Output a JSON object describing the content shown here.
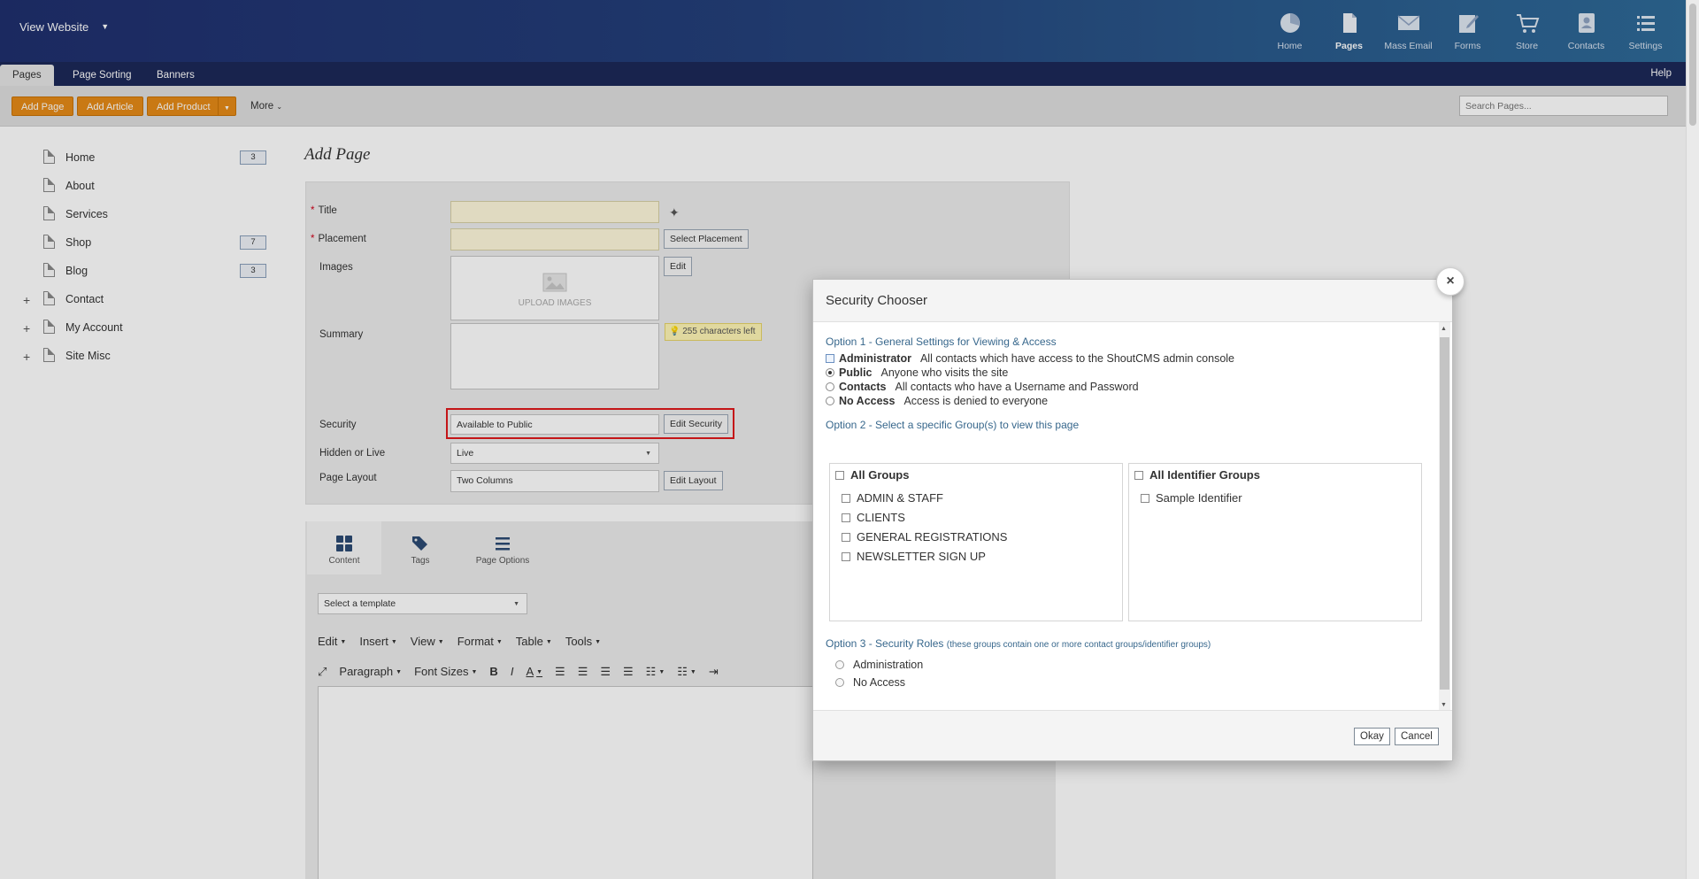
{
  "topbar": {
    "view_website": "View Website",
    "nav": [
      {
        "label": "Home",
        "icon": "pie-chart-icon"
      },
      {
        "label": "Pages",
        "icon": "page-icon"
      },
      {
        "label": "Mass Email",
        "icon": "envelope-icon"
      },
      {
        "label": "Forms",
        "icon": "pencil-form-icon"
      },
      {
        "label": "Store",
        "icon": "cart-icon"
      },
      {
        "label": "Contacts",
        "icon": "contact-card-icon"
      },
      {
        "label": "Settings",
        "icon": "list-icon"
      }
    ]
  },
  "subnav": {
    "tabs": [
      "Pages",
      "Page Sorting",
      "Banners"
    ],
    "help": "Help"
  },
  "actions": {
    "add_page": "Add Page",
    "add_article": "Add Article",
    "add_product": "Add Product",
    "more": "More",
    "search_placeholder": "Search Pages..."
  },
  "tree": [
    {
      "label": "Home",
      "count": "3",
      "expandable": false
    },
    {
      "label": "About",
      "count": "",
      "expandable": false
    },
    {
      "label": "Services",
      "count": "",
      "expandable": false
    },
    {
      "label": "Shop",
      "count": "7",
      "expandable": false
    },
    {
      "label": "Blog",
      "count": "3",
      "expandable": false
    },
    {
      "label": "Contact",
      "count": "",
      "expandable": true
    },
    {
      "label": "My Account",
      "count": "",
      "expandable": true
    },
    {
      "label": "Site Misc",
      "count": "",
      "expandable": true
    }
  ],
  "form": {
    "page_title": "Add Page",
    "title_label": "Title",
    "placement_label": "Placement",
    "select_placement": "Select Placement",
    "images_label": "Images",
    "edit": "Edit",
    "upload_images": "UPLOAD IMAGES",
    "summary_label": "Summary",
    "chars_left": "255 characters left",
    "security_label": "Security",
    "security_value": "Available to Public",
    "edit_security": "Edit Security",
    "hidden_label": "Hidden or Live",
    "hidden_value": "Live",
    "layout_label": "Page Layout",
    "layout_value": "Two Columns",
    "edit_layout": "Edit Layout"
  },
  "content_tabs": [
    "Content",
    "Tags",
    "Page Options"
  ],
  "editor": {
    "template_placeholder": "Select a template",
    "menu": [
      "Edit",
      "Insert",
      "View",
      "Format",
      "Table",
      "Tools"
    ],
    "toolbar": [
      "Paragraph",
      "Font Sizes"
    ]
  },
  "modal": {
    "title": "Security Chooser",
    "option1_heading": "Option 1 - General Settings for Viewing & Access",
    "option1": [
      {
        "name": "Administrator",
        "desc": "All contacts which have access to the ShoutCMS admin console",
        "selected": false
      },
      {
        "name": "Public",
        "desc": "Anyone who visits the site",
        "selected": true
      },
      {
        "name": "Contacts",
        "desc": "All contacts who have a Username and Password",
        "selected": false
      },
      {
        "name": "No Access",
        "desc": "Access is denied to everyone",
        "selected": false
      }
    ],
    "option2_heading": "Option 2 - Select a specific Group(s) to view this page",
    "all_groups": "All Groups",
    "groups": [
      "ADMIN & STAFF",
      "CLIENTS",
      "GENERAL REGISTRATIONS",
      "NEWSLETTER SIGN UP"
    ],
    "all_identifier_groups": "All Identifier Groups",
    "identifier_groups": [
      "Sample Identifier"
    ],
    "option3_heading": "Option 3 - Security Roles",
    "option3_sub": "(these groups contain one or more contact groups/identifier groups)",
    "roles": [
      "Administration",
      "No Access"
    ],
    "okay": "Okay",
    "cancel": "Cancel",
    "close": "×"
  }
}
